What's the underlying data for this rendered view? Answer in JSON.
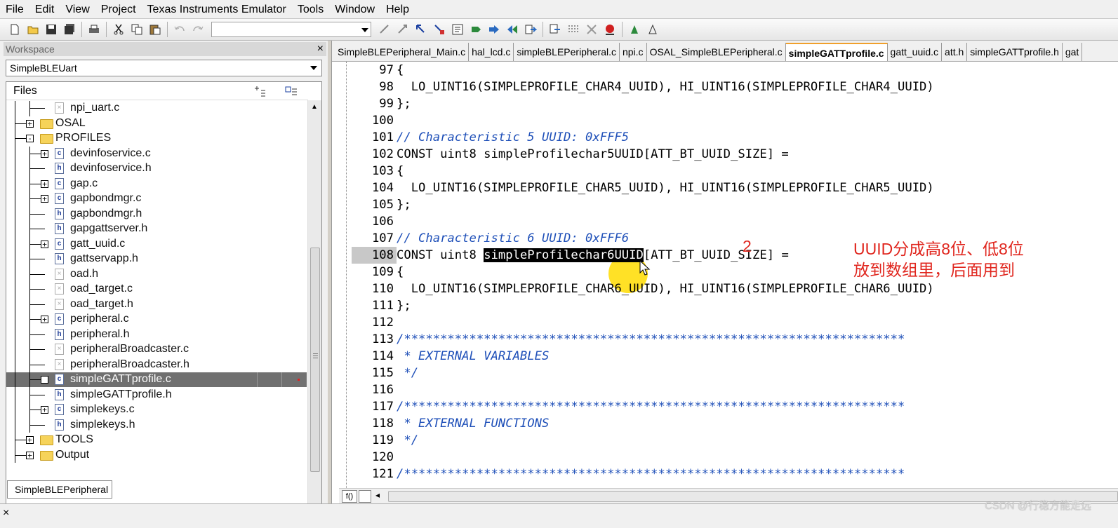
{
  "menu": [
    "File",
    "Edit",
    "View",
    "Project",
    "Texas Instruments Emulator",
    "Tools",
    "Window",
    "Help"
  ],
  "workspace": {
    "title": "Workspace",
    "close": "×",
    "selected_config": "SimpleBLEUart",
    "files_label": "Files",
    "bottom_tab": "SimpleBLEPeripheral",
    "tree": [
      {
        "label": "npi_uart.c",
        "kind": "file-gray",
        "depth": 2
      },
      {
        "label": "OSAL",
        "kind": "folder",
        "depth": 1,
        "toggle": "+"
      },
      {
        "label": "PROFILES",
        "kind": "folder",
        "depth": 1,
        "toggle": "-"
      },
      {
        "label": "devinfoservice.c",
        "kind": "c",
        "depth": 2,
        "toggle": "+"
      },
      {
        "label": "devinfoservice.h",
        "kind": "h",
        "depth": 2
      },
      {
        "label": "gap.c",
        "kind": "c",
        "depth": 2,
        "toggle": "+"
      },
      {
        "label": "gapbondmgr.c",
        "kind": "c",
        "depth": 2,
        "toggle": "+"
      },
      {
        "label": "gapbondmgr.h",
        "kind": "h",
        "depth": 2
      },
      {
        "label": "gapgattserver.h",
        "kind": "h",
        "depth": 2
      },
      {
        "label": "gatt_uuid.c",
        "kind": "c",
        "depth": 2,
        "toggle": "+"
      },
      {
        "label": "gattservapp.h",
        "kind": "h",
        "depth": 2
      },
      {
        "label": "oad.h",
        "kind": "file-gray",
        "depth": 2
      },
      {
        "label": "oad_target.c",
        "kind": "file-gray",
        "depth": 2
      },
      {
        "label": "oad_target.h",
        "kind": "file-gray",
        "depth": 2
      },
      {
        "label": "peripheral.c",
        "kind": "c",
        "depth": 2,
        "toggle": "+"
      },
      {
        "label": "peripheral.h",
        "kind": "h",
        "depth": 2
      },
      {
        "label": "peripheralBroadcaster.c",
        "kind": "file-gray",
        "depth": 2
      },
      {
        "label": "peripheralBroadcaster.h",
        "kind": "file-gray",
        "depth": 2
      },
      {
        "label": "simpleGATTprofile.c",
        "kind": "c",
        "depth": 2,
        "toggle": "+",
        "selected": true
      },
      {
        "label": "simpleGATTprofile.h",
        "kind": "h",
        "depth": 2
      },
      {
        "label": "simplekeys.c",
        "kind": "c",
        "depth": 2,
        "toggle": "+"
      },
      {
        "label": "simplekeys.h",
        "kind": "h",
        "depth": 2
      },
      {
        "label": "TOOLS",
        "kind": "folder",
        "depth": 1,
        "toggle": "+"
      },
      {
        "label": "Output",
        "kind": "folder",
        "depth": 1,
        "toggle": "+"
      }
    ]
  },
  "editor": {
    "tabs": [
      {
        "label": "SimpleBLEPeripheral_Main.c"
      },
      {
        "label": "hal_lcd.c"
      },
      {
        "label": "simpleBLEPeripheral.c"
      },
      {
        "label": "npi.c"
      },
      {
        "label": "OSAL_SimpleBLEPeripheral.c"
      },
      {
        "label": "simpleGATTprofile.c",
        "active": true
      },
      {
        "label": "gatt_uuid.c"
      },
      {
        "label": "att.h"
      },
      {
        "label": "simpleGATTprofile.h"
      },
      {
        "label": "gat"
      }
    ],
    "lines": [
      {
        "n": "97",
        "t": "{"
      },
      {
        "n": "98",
        "t": "  LO_UINT16(SIMPLEPROFILE_CHAR4_UUID), HI_UINT16(SIMPLEPROFILE_CHAR4_UUID)"
      },
      {
        "n": "99",
        "t": "};"
      },
      {
        "n": "100",
        "t": ""
      },
      {
        "n": "101",
        "t": "// Characteristic 5 UUID: 0xFFF5",
        "comment": true
      },
      {
        "n": "102",
        "t": "CONST uint8 simpleProfilechar5UUID[ATT_BT_UUID_SIZE] ="
      },
      {
        "n": "103",
        "t": "{"
      },
      {
        "n": "104",
        "t": "  LO_UINT16(SIMPLEPROFILE_CHAR5_UUID), HI_UINT16(SIMPLEPROFILE_CHAR5_UUID)"
      },
      {
        "n": "105",
        "t": "};"
      },
      {
        "n": "106",
        "t": ""
      },
      {
        "n": "107",
        "t": "// Characteristic 6 UUID: 0xFFF6",
        "comment": true
      },
      {
        "n": "108",
        "pre": "CONST uint8 ",
        "sel": "simpleProfilechar6UUID",
        "post": "[ATT_BT_UUID_SIZE] =",
        "current": true
      },
      {
        "n": "109",
        "t": "{"
      },
      {
        "n": "110",
        "t": "  LO_UINT16(SIMPLEPROFILE_CHAR6_UUID), HI_UINT16(SIMPLEPROFILE_CHAR6_UUID)"
      },
      {
        "n": "111",
        "t": "};"
      },
      {
        "n": "112",
        "t": ""
      },
      {
        "n": "113",
        "t": "/*********************************************************************",
        "comment": true
      },
      {
        "n": "114",
        "t": " * EXTERNAL VARIABLES",
        "comment": true
      },
      {
        "n": "115",
        "t": " */",
        "comment": true
      },
      {
        "n": "116",
        "t": ""
      },
      {
        "n": "117",
        "t": "/*********************************************************************",
        "comment": true
      },
      {
        "n": "118",
        "t": " * EXTERNAL FUNCTIONS",
        "comment": true
      },
      {
        "n": "119",
        "t": " */",
        "comment": true
      },
      {
        "n": "120",
        "t": ""
      },
      {
        "n": "121",
        "t": "/*********************************************************************",
        "comment": true
      }
    ],
    "hbar_btn": "f()"
  },
  "annotation": {
    "number": "2",
    "text_line1": "UUID分成高8位、低8位",
    "text_line2": "放到数组里，后面用到"
  },
  "watermark": "CSDN @行稳方能走远",
  "bottom_close": "×",
  "colors": {
    "comment": "#1e4fb8",
    "annotation": "#e0261e",
    "selection_bg": "#707070"
  }
}
